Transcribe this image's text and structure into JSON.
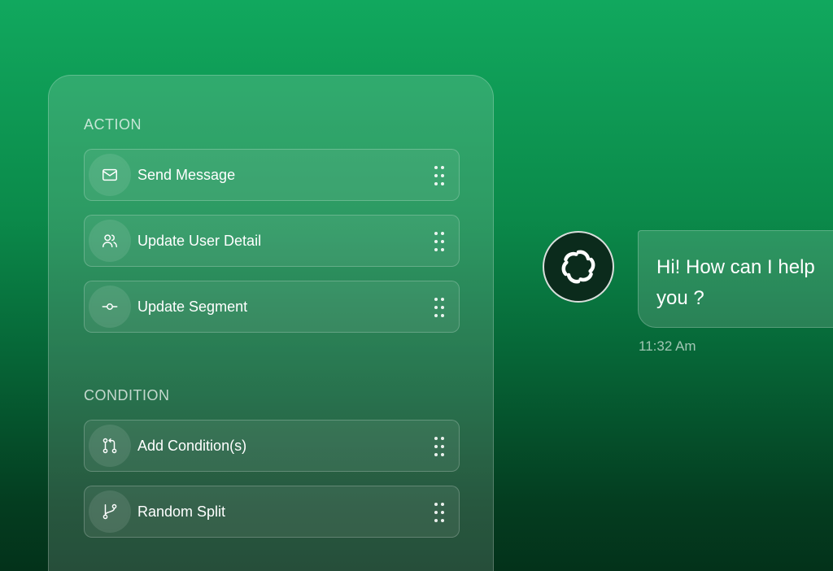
{
  "panel": {
    "action_section": {
      "title": "ACTION",
      "items": [
        {
          "label": "Send Message",
          "icon": "mail-icon"
        },
        {
          "label": "Update User Detail",
          "icon": "users-icon"
        },
        {
          "label": "Update Segment",
          "icon": "commit-icon"
        }
      ]
    },
    "condition_section": {
      "title": "CONDITION",
      "items": [
        {
          "label": "Add Condition(s)",
          "icon": "git-pull-request-icon"
        },
        {
          "label": "Random Split",
          "icon": "git-branch-icon"
        }
      ]
    }
  },
  "chat": {
    "avatar_icon": "bot-logo-icon",
    "message": "Hi! How can I help\nyou ?",
    "timestamp": "11:32 Am"
  },
  "colors": {
    "background_top": "#11a85e",
    "background_bottom": "#03321a",
    "avatar_background": "#0b2b1c"
  }
}
